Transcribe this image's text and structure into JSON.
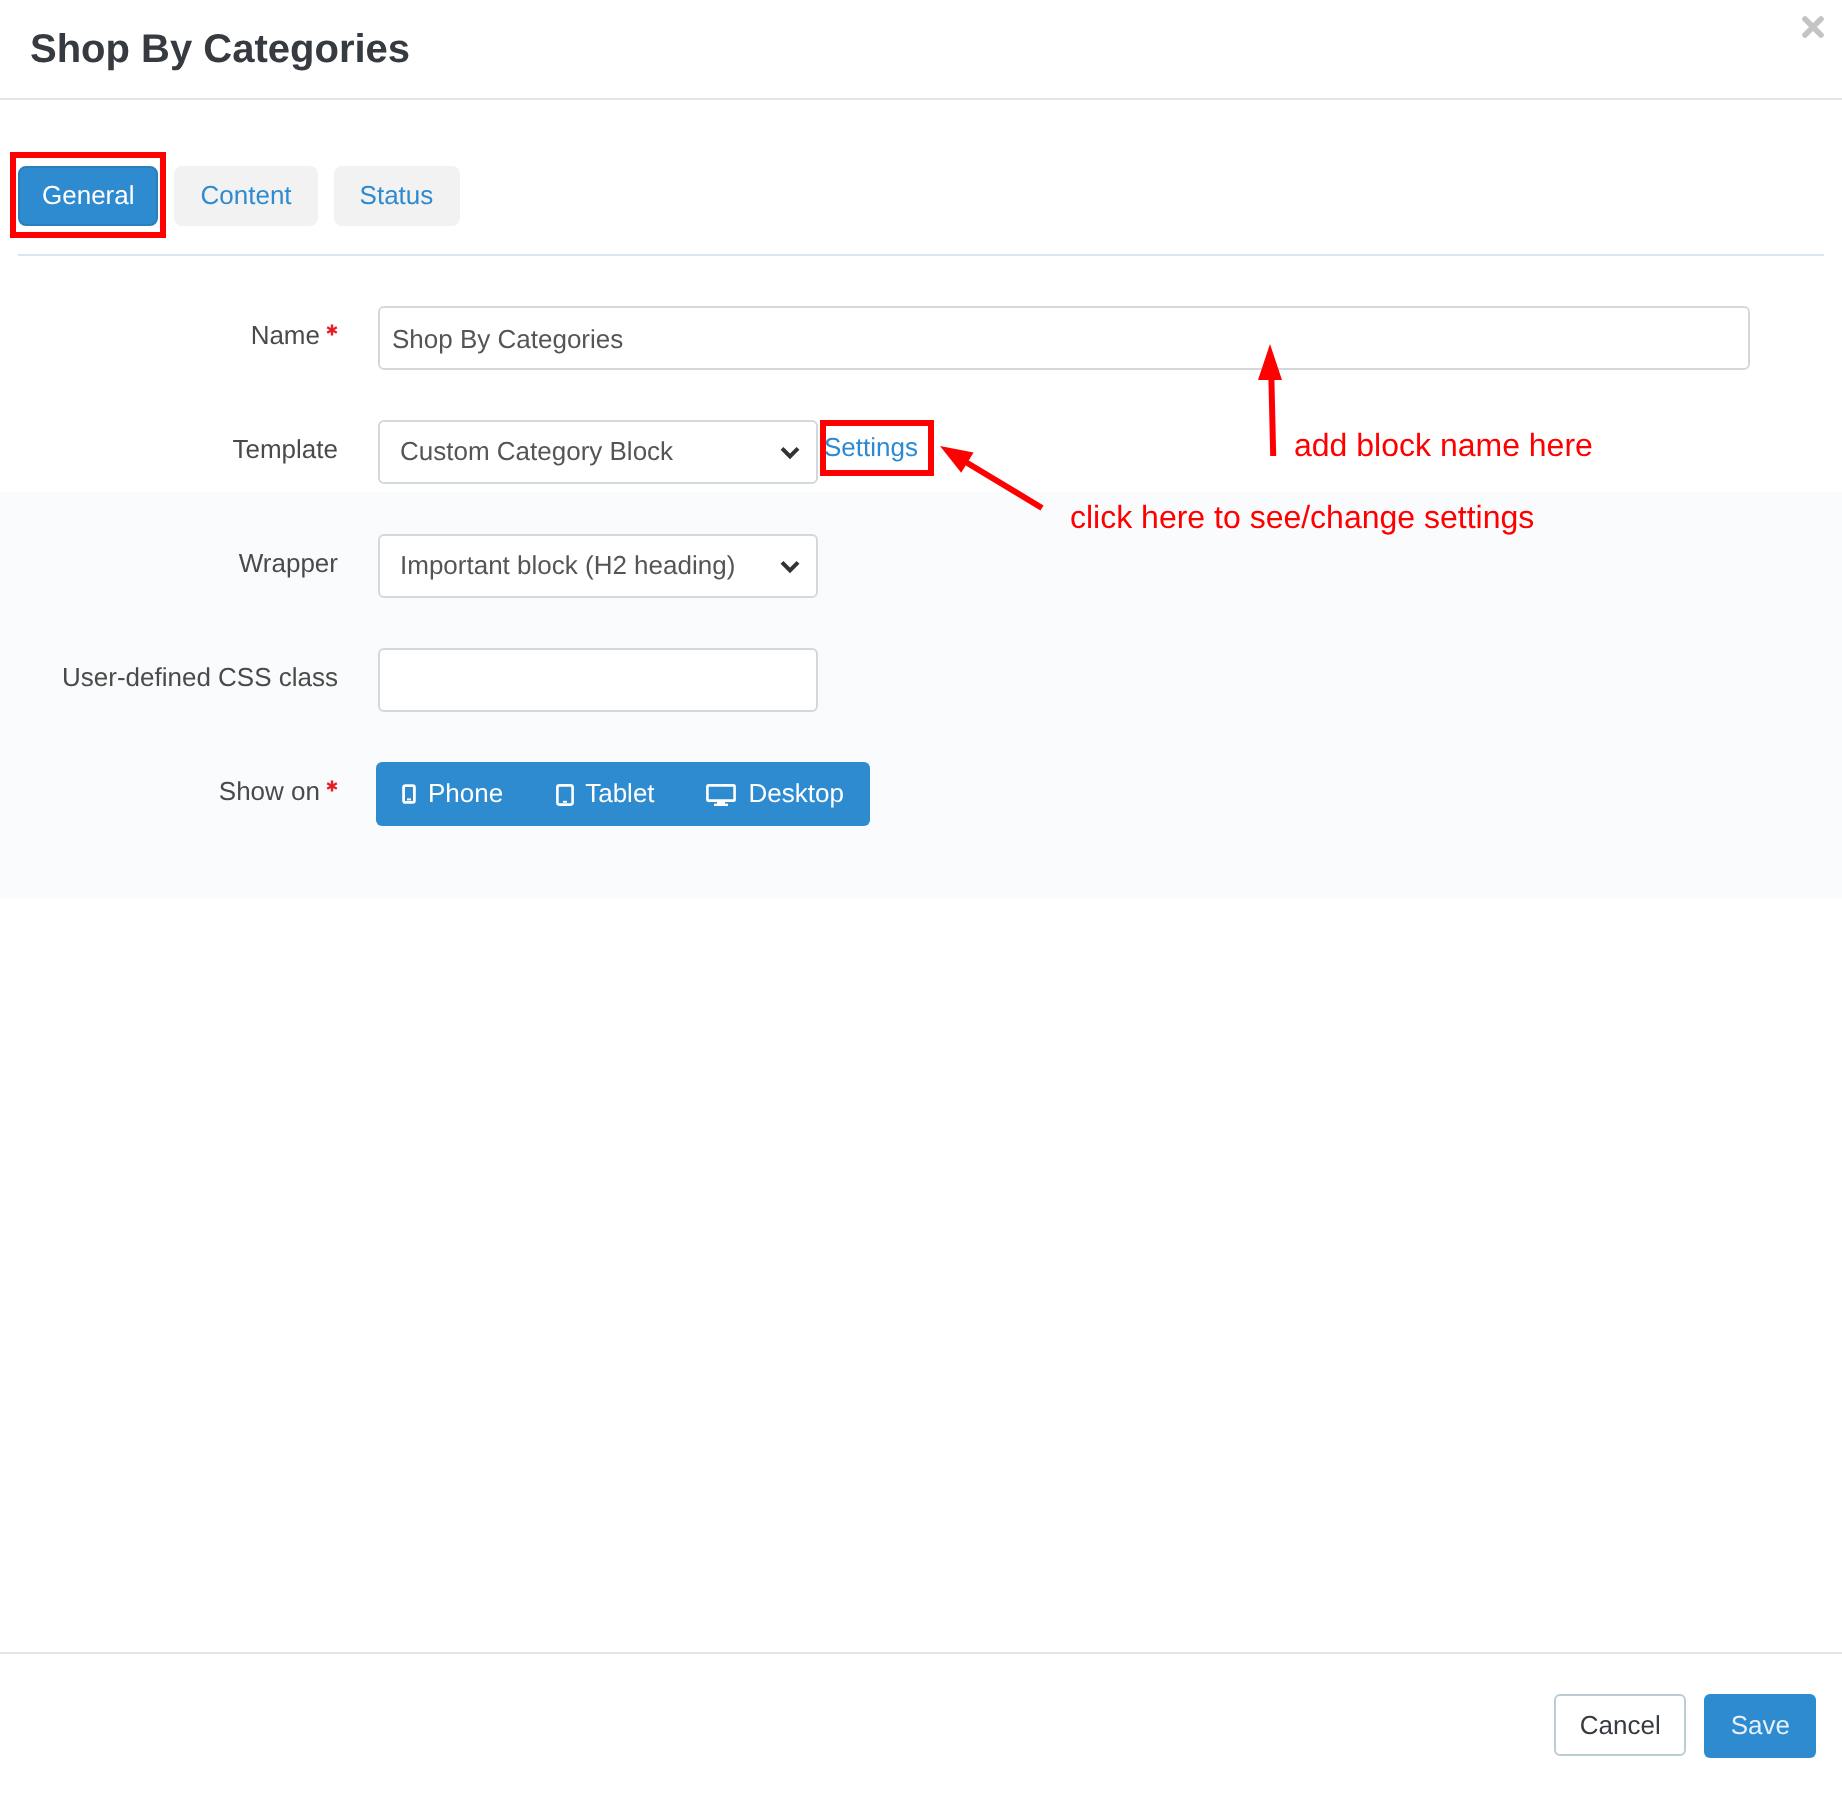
{
  "window": {
    "title": "Shop By Categories"
  },
  "tabs": [
    {
      "label": "General",
      "selected": true,
      "highlighted": true
    },
    {
      "label": "Content",
      "selected": false,
      "highlighted": false
    },
    {
      "label": "Status",
      "selected": false,
      "highlighted": false
    }
  ],
  "form": {
    "fields": [
      {
        "kind": "text",
        "label": "Name",
        "required": true,
        "value": "Shop By Categories"
      },
      {
        "kind": "select",
        "label": "Template",
        "required": false,
        "value": "Custom Category Block",
        "link": {
          "label": "Settings",
          "highlighted": true
        }
      },
      {
        "kind": "select",
        "label": "Wrapper",
        "required": false,
        "value": "Important block (H2 heading)"
      },
      {
        "kind": "text",
        "label": "User-defined CSS class",
        "required": false
      },
      {
        "kind": "devices",
        "label": "Show on",
        "required": true,
        "options": [
          {
            "kind": "phone",
            "label": "Phone"
          },
          {
            "kind": "tablet",
            "label": "Tablet"
          },
          {
            "kind": "desktop",
            "label": "Desktop"
          }
        ]
      }
    ]
  },
  "annotations": [
    {
      "kind": "arrow-up",
      "text": "add block name here"
    },
    {
      "kind": "arrow-left",
      "text": "click here to see/change settings"
    }
  ],
  "footer": {
    "buttons": [
      {
        "kind": "default",
        "label": "Cancel"
      },
      {
        "kind": "primary",
        "label": "Save"
      }
    ]
  }
}
